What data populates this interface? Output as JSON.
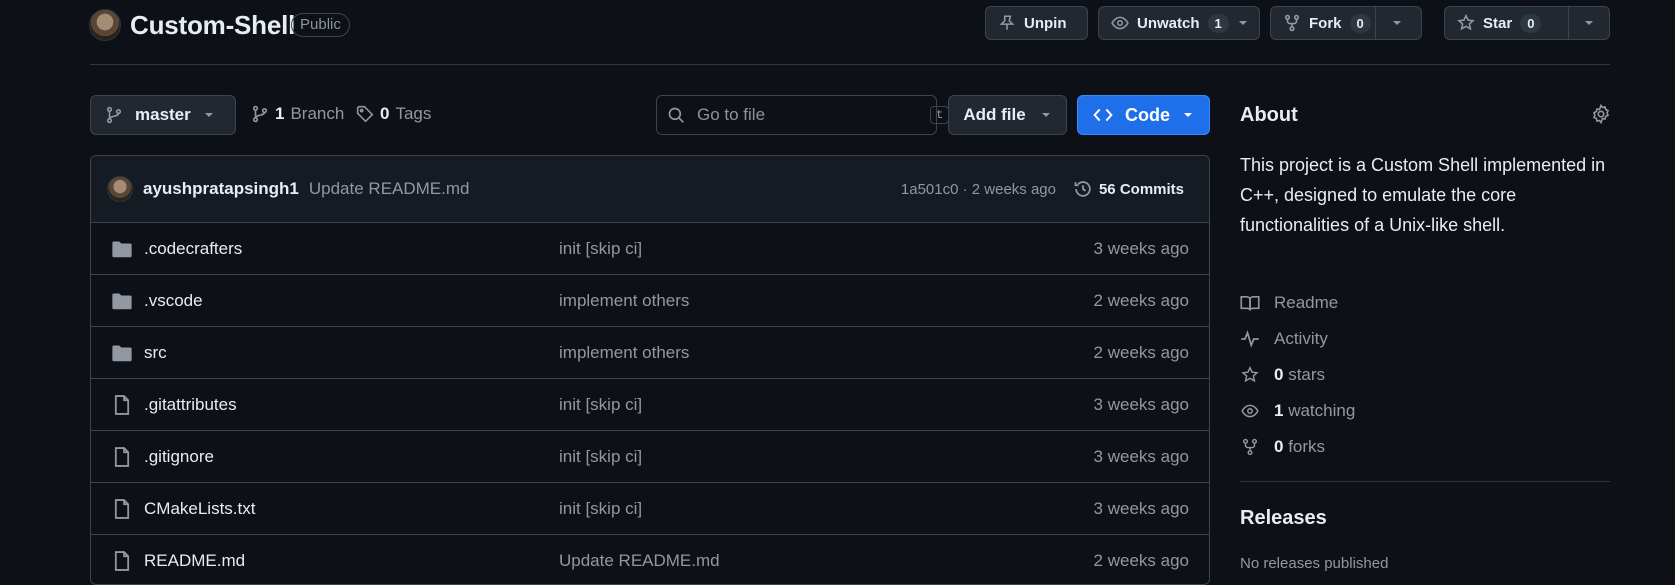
{
  "header": {
    "repo_name": "Custom-Shell",
    "visibility": "Public",
    "unpin_label": "Unpin",
    "unwatch_label": "Unwatch",
    "watch_count": "1",
    "fork_label": "Fork",
    "fork_count": "0",
    "star_label": "Star",
    "star_count": "0"
  },
  "toolbar": {
    "branch": "master",
    "branches_count": "1",
    "branches_label": "Branch",
    "tags_count": "0",
    "tags_label": "Tags",
    "search_placeholder": "Go to file",
    "search_shortcut": "t",
    "add_file_label": "Add file",
    "code_label": "Code"
  },
  "latest_commit": {
    "author": "ayushpratapsingh1",
    "message": "Update README.md",
    "hash_time": "1a501c0 · 2 weeks ago",
    "commits_label": "56 Commits"
  },
  "files": [
    {
      "type": "folder",
      "name": ".codecrafters",
      "message": "init [skip ci]",
      "age": "3 weeks ago"
    },
    {
      "type": "folder",
      "name": ".vscode",
      "message": "implement others",
      "age": "2 weeks ago"
    },
    {
      "type": "folder",
      "name": "src",
      "message": "implement others",
      "age": "2 weeks ago"
    },
    {
      "type": "file",
      "name": ".gitattributes",
      "message": "init [skip ci]",
      "age": "3 weeks ago"
    },
    {
      "type": "file",
      "name": ".gitignore",
      "message": "init [skip ci]",
      "age": "3 weeks ago"
    },
    {
      "type": "file",
      "name": "CMakeLists.txt",
      "message": "init [skip ci]",
      "age": "3 weeks ago"
    },
    {
      "type": "file",
      "name": "README.md",
      "message": "Update README.md",
      "age": "2 weeks ago"
    }
  ],
  "about": {
    "title": "About",
    "description": "This project is a Custom Shell implemented in C++, designed to emulate the core functionalities of a Unix-like shell.",
    "readme_label": "Readme",
    "activity_label": "Activity",
    "stars_count": "0",
    "stars_label": "stars",
    "watching_count": "1",
    "watching_label": "watching",
    "forks_count": "0",
    "forks_label": "forks"
  },
  "releases": {
    "title": "Releases",
    "empty_text": "No releases published"
  },
  "colors": {
    "background": "#0d1117",
    "accent": "#1f6feb",
    "border": "#3d444d",
    "muted_text": "#9198a1"
  }
}
